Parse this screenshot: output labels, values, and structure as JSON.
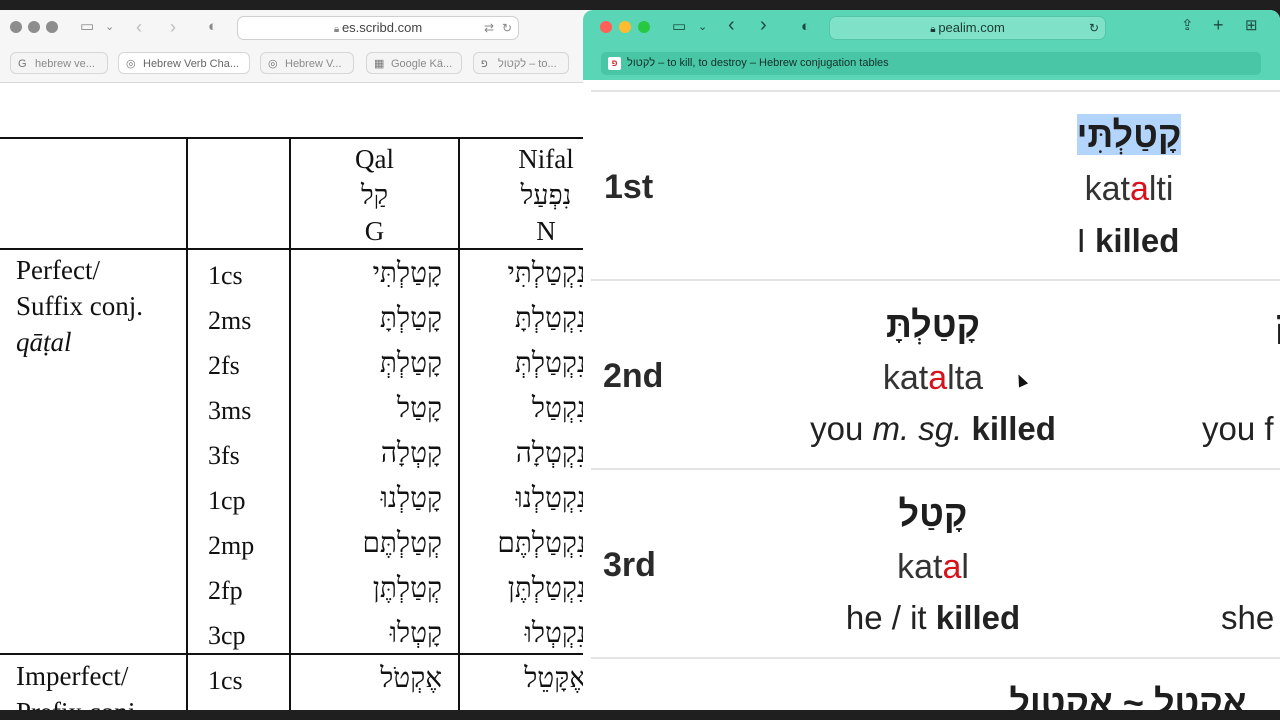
{
  "left_browser": {
    "url": "es.scribd.com",
    "tabs": [
      {
        "icon": "G",
        "label": "hebrew ve..."
      },
      {
        "icon": "◎",
        "label": "Hebrew Verb Cha..."
      },
      {
        "icon": "◎",
        "label": "Hebrew V..."
      },
      {
        "icon": "▦",
        "label": "Google Kä..."
      },
      {
        "icon": "פ",
        "label": "לקטול – to..."
      }
    ]
  },
  "verb_table": {
    "columns": [
      {
        "name": "Qal",
        "hebrew": "קַל",
        "code": "G"
      },
      {
        "name": "Nifal",
        "hebrew": "נִפְעַל",
        "code": "N"
      }
    ],
    "perfect_label": [
      "Perfect/",
      "Suffix conj.",
      "qāṭal"
    ],
    "imperfect_label": [
      "Imperfect/",
      "Prefix conj."
    ],
    "persons": [
      "1cs",
      "2ms",
      "2fs",
      "3ms",
      "3fs",
      "1cp",
      "2mp",
      "2fp",
      "3cp"
    ],
    "qal_forms": [
      "קָטַלְתִּי",
      "קָטַלְתָּ",
      "קָטַלְתְּ",
      "קָטַל",
      "קָטְלָה",
      "קָטַלְנוּ",
      "קְטַלְתֶּם",
      "קְטַלְתֶּן",
      "קָטְלוּ"
    ],
    "nifal_forms": [
      "נִקְטַלְתִּי",
      "נִקְטַלְתָּ",
      "נִקְטַלְתְּ",
      "נִקְטַל",
      "נִקְטְלָה",
      "נִקְטַלְנוּ",
      "נִקְטַלְתֶּם",
      "נִקְטַלְתֶּן",
      "נִקְטְלוּ"
    ],
    "imperfect_person": "1cs",
    "imperfect_qal": "אֶקְטֹל",
    "imperfect_nifal": "אֶקָּטֵל"
  },
  "right_browser": {
    "url": "pealim.com",
    "tab_favicon": "פ",
    "tab_title": "לקטול – to kill, to destroy – Hebrew conjugation tables",
    "rows": [
      {
        "person": "1st",
        "hebrew": "קָטַלְתִּי",
        "translit_pre": "kat",
        "translit_acc": "a",
        "translit_post": "lti",
        "gloss_pre": "I ",
        "gloss_em": "",
        "gloss_mid": "",
        "gloss_bold": "killed"
      },
      {
        "person": "2nd",
        "hebrew": "קָטַלְתָּ",
        "translit_pre": "kat",
        "translit_acc": "a",
        "translit_post": "lta",
        "gloss_pre": "you ",
        "gloss_em": "m. sg.",
        "gloss_mid": " ",
        "gloss_bold": "killed",
        "extra_gloss": "you f",
        "extra_heb": "ק"
      },
      {
        "person": "3rd",
        "hebrew": "קָטַל",
        "translit_pre": "kat",
        "translit_acc": "a",
        "translit_post": "l",
        "gloss_pre": "he / it ",
        "gloss_em": "",
        "gloss_mid": "",
        "gloss_bold": "killed",
        "extra_gloss": "she"
      }
    ],
    "bottom_partial": "אקטל ~ אקטול"
  }
}
